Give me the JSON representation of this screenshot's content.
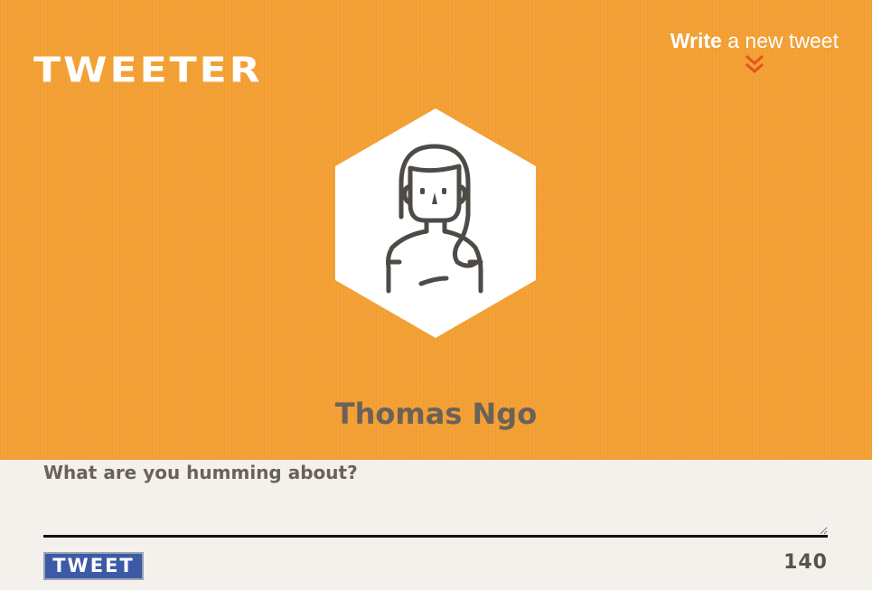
{
  "header": {
    "logo_text": "TWEETER",
    "write_link": {
      "bold_text": "Write",
      "light_text": " a new tweet",
      "icon": "double-chevron-down-icon"
    }
  },
  "profile": {
    "avatar_icon": "user-avatar-icon",
    "name": "Thomas Ngo"
  },
  "compose": {
    "prompt": "What are you humming about?",
    "input_value": "",
    "input_placeholder": "",
    "button_label": "TWEET",
    "char_count": "140"
  },
  "colors": {
    "hero_background": "#f4a034",
    "accent_chevron": "#e8521a",
    "button_background": "#3c5aa6",
    "text_muted": "#6b6158",
    "page_background": "#f4f1ed"
  }
}
